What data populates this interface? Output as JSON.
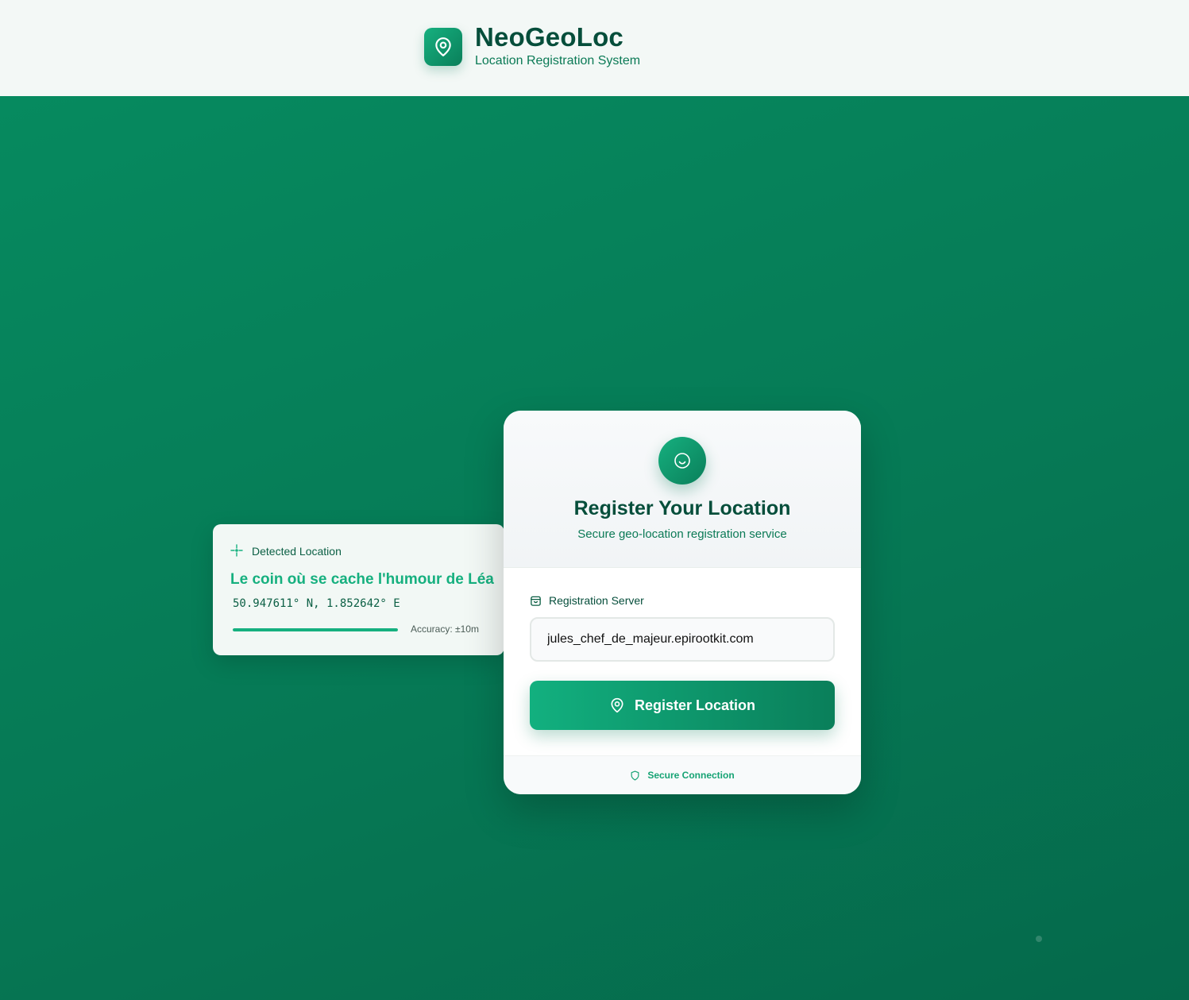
{
  "header": {
    "title": "NeoGeoLoc",
    "subtitle": "Location Registration System",
    "logo_icon": "map-pin-icon"
  },
  "detected": {
    "label": "Detected Location",
    "icon": "crosshair-icon",
    "name": "Le coin où se cache l'humour de Léa",
    "coords": "50.947611° N, 1.852642° E",
    "accuracy": "Accuracy: ±10m",
    "accuracy_bar_fill": 1.0
  },
  "register": {
    "avatar_icon": "smile-icon",
    "title": "Register Your Location",
    "subtitle": "Secure geo-location registration service",
    "field_label": "Registration Server",
    "field_icon": "server-icon",
    "server_value": "jules_chef_de_majeur.epirootkit.com",
    "button_label": "Register Location",
    "button_icon": "map-pin-icon",
    "footer": "Secure Connection",
    "footer_icon": "shield-icon"
  },
  "colors": {
    "brand_dark": "#064e3b",
    "brand_accent": "#16b07f",
    "background_green": "#067955"
  }
}
